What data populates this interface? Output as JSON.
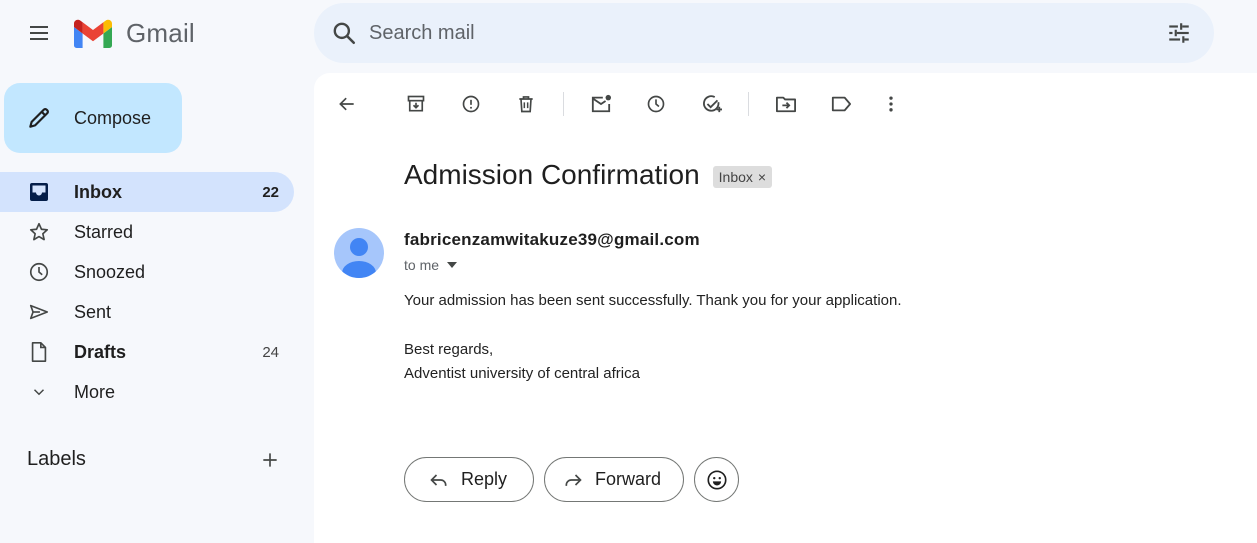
{
  "header": {
    "app_name": "Gmail",
    "menu_icon": "hamburger-menu-icon",
    "search_placeholder": "Search mail",
    "search_icon": "search-icon",
    "filter_icon": "search-options-icon"
  },
  "sidebar": {
    "compose_label": "Compose",
    "items": [
      {
        "label": "Inbox",
        "count": "22",
        "icon": "inbox-icon",
        "active": true,
        "bold": true
      },
      {
        "label": "Starred",
        "count": "",
        "icon": "star-icon"
      },
      {
        "label": "Snoozed",
        "count": "",
        "icon": "clock-icon"
      },
      {
        "label": "Sent",
        "count": "",
        "icon": "send-icon"
      },
      {
        "label": "Drafts",
        "count": "24",
        "icon": "draft-file-icon",
        "bold": true
      },
      {
        "label": "More",
        "count": "",
        "icon": "chevron-down-icon"
      }
    ],
    "labels_title": "Labels"
  },
  "toolbar": {
    "icons": [
      "back-arrow-icon",
      "archive-icon",
      "report-spam-icon",
      "delete-icon",
      "mark-unread-icon",
      "snooze-icon",
      "add-to-tasks-icon",
      "move-to-icon",
      "label-icon",
      "more-vert-icon"
    ]
  },
  "message": {
    "subject": "Admission Confirmation",
    "label_chip": "Inbox",
    "chip_close": "×",
    "sender": "fabricenzamwitakuze39@gmail.com",
    "recipient": "to me",
    "body_line1": "Your admission has been sent successfully. Thank you for your application.",
    "body_line2": "Best regards,",
    "body_line3": "Adventist university of central africa"
  },
  "actions": {
    "reply_label": "Reply",
    "forward_label": "Forward"
  },
  "colors": {
    "background": "#f6f8fc",
    "compose_bg": "#c2e7ff",
    "active_nav_bg": "#d3e3fd",
    "search_bg": "#eaf1fb",
    "avatar_bg": "#a6c6fb",
    "avatar_fg": "#4285f4"
  }
}
